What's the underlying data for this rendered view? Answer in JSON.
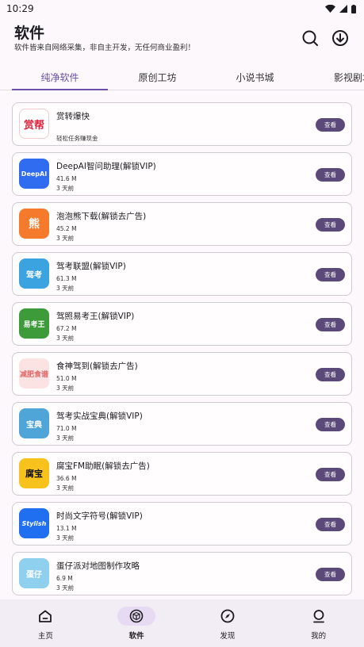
{
  "status_bar": {
    "time": "10:29"
  },
  "header": {
    "title": "软件",
    "subtitle": "软件皆来自网络采集，非自主开发，无任何商业盈利！",
    "search_icon": "search-icon",
    "download_icon": "download-icon"
  },
  "tabs": [
    {
      "label": "纯净软件",
      "active": true
    },
    {
      "label": "原创工坊",
      "active": false
    },
    {
      "label": "小说书城",
      "active": false
    },
    {
      "label": "影视剧场",
      "active": false
    }
  ],
  "apps": [
    {
      "name": "赏转爆快",
      "size": "",
      "time": "轻松任务赚现金",
      "button": "查看",
      "icon_text": "赏帮",
      "icon_bg": "#ffffff",
      "icon_fg": "#e0203a"
    },
    {
      "name": "DeepAI智问助理(解锁VIP)",
      "size": "41.6 M",
      "time": "3 天前",
      "button": "查看",
      "icon_text": "DeepAI",
      "icon_bg": "#2f6cf0",
      "icon_fg": "#ffffff"
    },
    {
      "name": "泡泡熊下载(解锁去广告)",
      "size": "45.2 M",
      "time": "3 天前",
      "button": "查看",
      "icon_text": "熊",
      "icon_bg": "#f57a2c",
      "icon_fg": "#ffffff"
    },
    {
      "name": "驾考联盟(解锁VIP)",
      "size": "61.3 M",
      "time": "3 天前",
      "button": "查看",
      "icon_text": "驾考",
      "icon_bg": "#3aa3e0",
      "icon_fg": "#ffffff"
    },
    {
      "name": "驾照易考王(解锁VIP)",
      "size": "67.2 M",
      "time": "3 天前",
      "button": "查看",
      "icon_text": "易考王",
      "icon_bg": "#3d9b3a",
      "icon_fg": "#ffffff"
    },
    {
      "name": "食神驾到(解锁去广告)",
      "size": "51.0 M",
      "time": "3 天前",
      "button": "查看",
      "icon_text": "减肥食谱",
      "icon_bg": "#fbe3e3",
      "icon_fg": "#e06a6a"
    },
    {
      "name": "驾考实战宝典(解锁VIP)",
      "size": "71.0 M",
      "time": "3 天前",
      "button": "查看",
      "icon_text": "宝典",
      "icon_bg": "#4fa4d8",
      "icon_fg": "#ffffff"
    },
    {
      "name": "腐宝FM助眠(解锁去广告)",
      "size": "36.6 M",
      "time": "3 天前",
      "button": "查看",
      "icon_text": "腐宝",
      "icon_bg": "#f6c21b",
      "icon_fg": "#111111"
    },
    {
      "name": "时尚文字符号(解锁VIP)",
      "size": "13.1 M",
      "time": "3 天前",
      "button": "查看",
      "icon_text": "Stylish",
      "icon_bg": "#1f6ff0",
      "icon_fg": "#ffffff"
    },
    {
      "name": "蛋仔派对地图制作攻略",
      "size": "6.9 M",
      "time": "3 天前",
      "button": "查看",
      "icon_text": "蛋仔",
      "icon_bg": "#8fd0ee",
      "icon_fg": "#ffffff"
    }
  ],
  "bottom_nav": [
    {
      "label": "主页",
      "icon": "home-icon",
      "active": false
    },
    {
      "label": "软件",
      "icon": "cube-icon",
      "active": true
    },
    {
      "label": "发现",
      "icon": "compass-icon",
      "active": false
    },
    {
      "label": "我的",
      "icon": "profile-icon",
      "active": false
    }
  ],
  "colors": {
    "accent": "#6b4fa8",
    "button": "#5b4a79",
    "nav_bg": "#f2ecf4"
  }
}
